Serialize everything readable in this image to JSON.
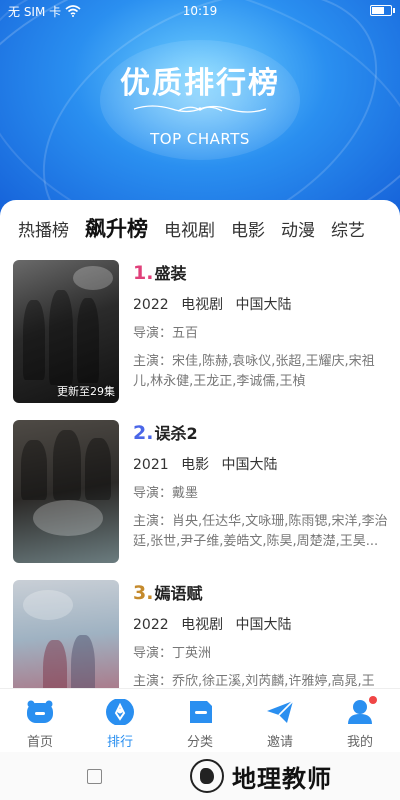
{
  "status_bar": {
    "carrier": "无 SIM 卡",
    "time": "10:19",
    "battery_level": 0.7
  },
  "header": {
    "title": "优质排行榜",
    "subtitle": "TOP CHARTS"
  },
  "tabs": [
    {
      "label": "热播榜",
      "active": false
    },
    {
      "label": "飙升榜",
      "active": true
    },
    {
      "label": "电视剧",
      "active": false
    },
    {
      "label": "电影",
      "active": false
    },
    {
      "label": "动漫",
      "active": false
    },
    {
      "label": "综艺",
      "active": false
    }
  ],
  "items": [
    {
      "rank": "1.",
      "title": "盛装",
      "year": "2022",
      "type": "电视剧",
      "region": "中国大陆",
      "director": "导演：五百",
      "cast": "主演：宋佳,陈赫,袁咏仪,张超,王耀庆,宋祖儿,林永健,王龙正,李诚儒,王楨",
      "poster_tag": "更新至29集"
    },
    {
      "rank": "2.",
      "title": "误杀2",
      "year": "2021",
      "type": "电影",
      "region": "中国大陆",
      "director": "导演：戴墨",
      "cast": "主演：肖央,任达华,文咏珊,陈雨锶,宋洋,李治廷,张世,尹子维,姜皓文,陈昊,周楚濋,王昊...",
      "poster_tag": ""
    },
    {
      "rank": "3.",
      "title": "嫣语赋",
      "year": "2022",
      "type": "电视剧",
      "region": "中国大陆",
      "director": "导演：丁英洲",
      "cast": "主演：乔欣,徐正溪,刘芮麟,许雅婷,高晁,王倩,戈宇",
      "poster_tag": ""
    }
  ],
  "bottom_nav": [
    {
      "label": "首页",
      "icon": "home-icon",
      "active": false
    },
    {
      "label": "排行",
      "icon": "ranking-icon",
      "active": true
    },
    {
      "label": "分类",
      "icon": "category-icon",
      "active": false
    },
    {
      "label": "邀请",
      "icon": "invite-icon",
      "active": false
    },
    {
      "label": "我的",
      "icon": "profile-icon",
      "active": false,
      "badge": true
    }
  ],
  "watermark": {
    "text": "地理教师"
  },
  "colors": {
    "accent": "#2a8ff0",
    "rank1": "#e0407a",
    "rank2": "#4a66e8",
    "rank3": "#c48a2c",
    "badge": "#f04545"
  }
}
